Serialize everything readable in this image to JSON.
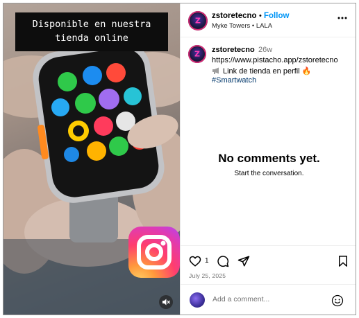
{
  "video": {
    "overlay_text_line1": "Disponible en nuestra",
    "overlay_text_line2": "tienda online",
    "mute_icon": "speaker-muted-icon",
    "logo_icon": "instagram-logo"
  },
  "header": {
    "username": "zstoretecno",
    "separator": "•",
    "follow_label": "Follow",
    "audio_line": "Myke Towers • LALA",
    "more_icon": "more-horizontal-icon"
  },
  "caption": {
    "username": "zstoretecno",
    "time": "26w",
    "line1": "https://www.pistacho.app/zstoretecno",
    "line2": "Link de tienda en perfil 🔥",
    "hashtag": "#Smartwatch"
  },
  "comments": {
    "empty_title": "No comments yet.",
    "empty_subtitle": "Start the conversation."
  },
  "actions": {
    "like_count": "1",
    "date": "July 25, 2025",
    "like_icon": "heart-icon",
    "comment_icon": "comment-icon",
    "share_icon": "send-icon",
    "save_icon": "bookmark-icon"
  },
  "comment_bar": {
    "placeholder": "Add a comment...",
    "emoji_icon": "emoji-icon"
  },
  "colors": {
    "link_blue": "#0095f6",
    "hashtag_blue": "#00376b",
    "muted_text": "#737373",
    "divider": "#efefef"
  }
}
